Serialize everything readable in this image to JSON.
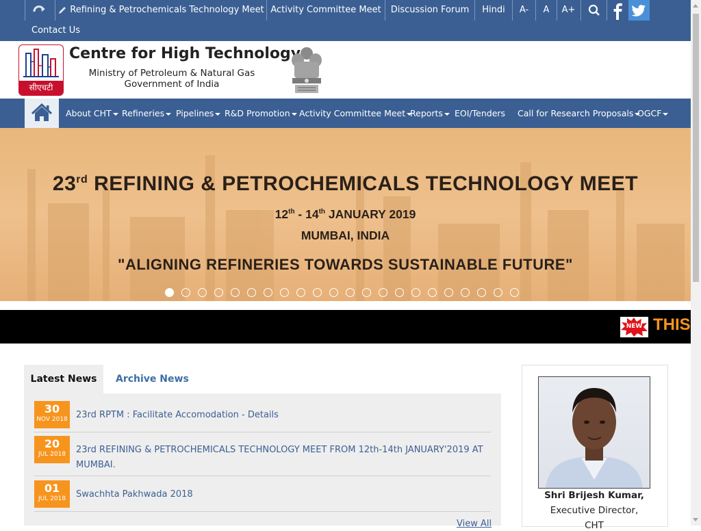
{
  "topbar": {
    "items": [
      "Refining & Petrochemicals Technology Meet",
      "Activity Committee Meet",
      "Discussion Forum",
      "Hindi",
      "A-",
      "A",
      "A+"
    ],
    "contact": "Contact Us",
    "icons": [
      "refresh-icon",
      "pencil-icon",
      "search-icon",
      "facebook-icon",
      "twitter-icon"
    ]
  },
  "header": {
    "title": "Centre for High Technology",
    "ministry": "Ministry of Petroleum & Natural Gas",
    "government": "Government of India",
    "logo_text": "सीएचटी"
  },
  "nav": {
    "items": [
      "About CHT",
      "Refineries",
      "Pipelines",
      "R&D Promotion",
      "Activity Committee Meet",
      "Reports",
      "EOI/Tenders",
      "Call for Research Proposals",
      "OGCF"
    ]
  },
  "banner": {
    "ordinal_num": "23",
    "ordinal_sup": "rd",
    "title_rest": " REFINING & PETROCHEMICALS TECHNOLOGY MEET",
    "date_a": "12",
    "date_a_sup": "th",
    "date_mid": " - 14",
    "date_b_sup": "th",
    "date_rest": " JANUARY 2019",
    "location": "MUMBAI, INDIA",
    "tagline": "\"ALIGNING REFINERIES TOWARDS SUSTAINABLE FUTURE\"",
    "slides_total": 22,
    "active_slide": 1
  },
  "ticker": {
    "badge": "NEW",
    "text": "THIS"
  },
  "news": {
    "tabs": [
      "Latest News",
      "Archive News"
    ],
    "active_tab": "Latest News",
    "items": [
      {
        "day": "30",
        "month": "NOV 2018",
        "text": "23rd RPTM : Facilitate Accomodation - Details"
      },
      {
        "day": "20",
        "month": "JUL 2018",
        "text": "23rd REFINING & PETROCHEMICALS TECHNOLOGY MEET FROM 12th-14th JANUARY'2019 AT MUMBAI."
      },
      {
        "day": "01",
        "month": "JUL 2018",
        "text": "Swachhta Pakhwada 2018"
      }
    ],
    "view_all": "View All"
  },
  "profile": {
    "name": "Shri Brijesh Kumar,",
    "designation": "Executive Director,",
    "org": "CHT"
  },
  "colors": {
    "primary": "#3b5f93",
    "accent": "#f7941d",
    "ticker_bg": "#000000"
  }
}
